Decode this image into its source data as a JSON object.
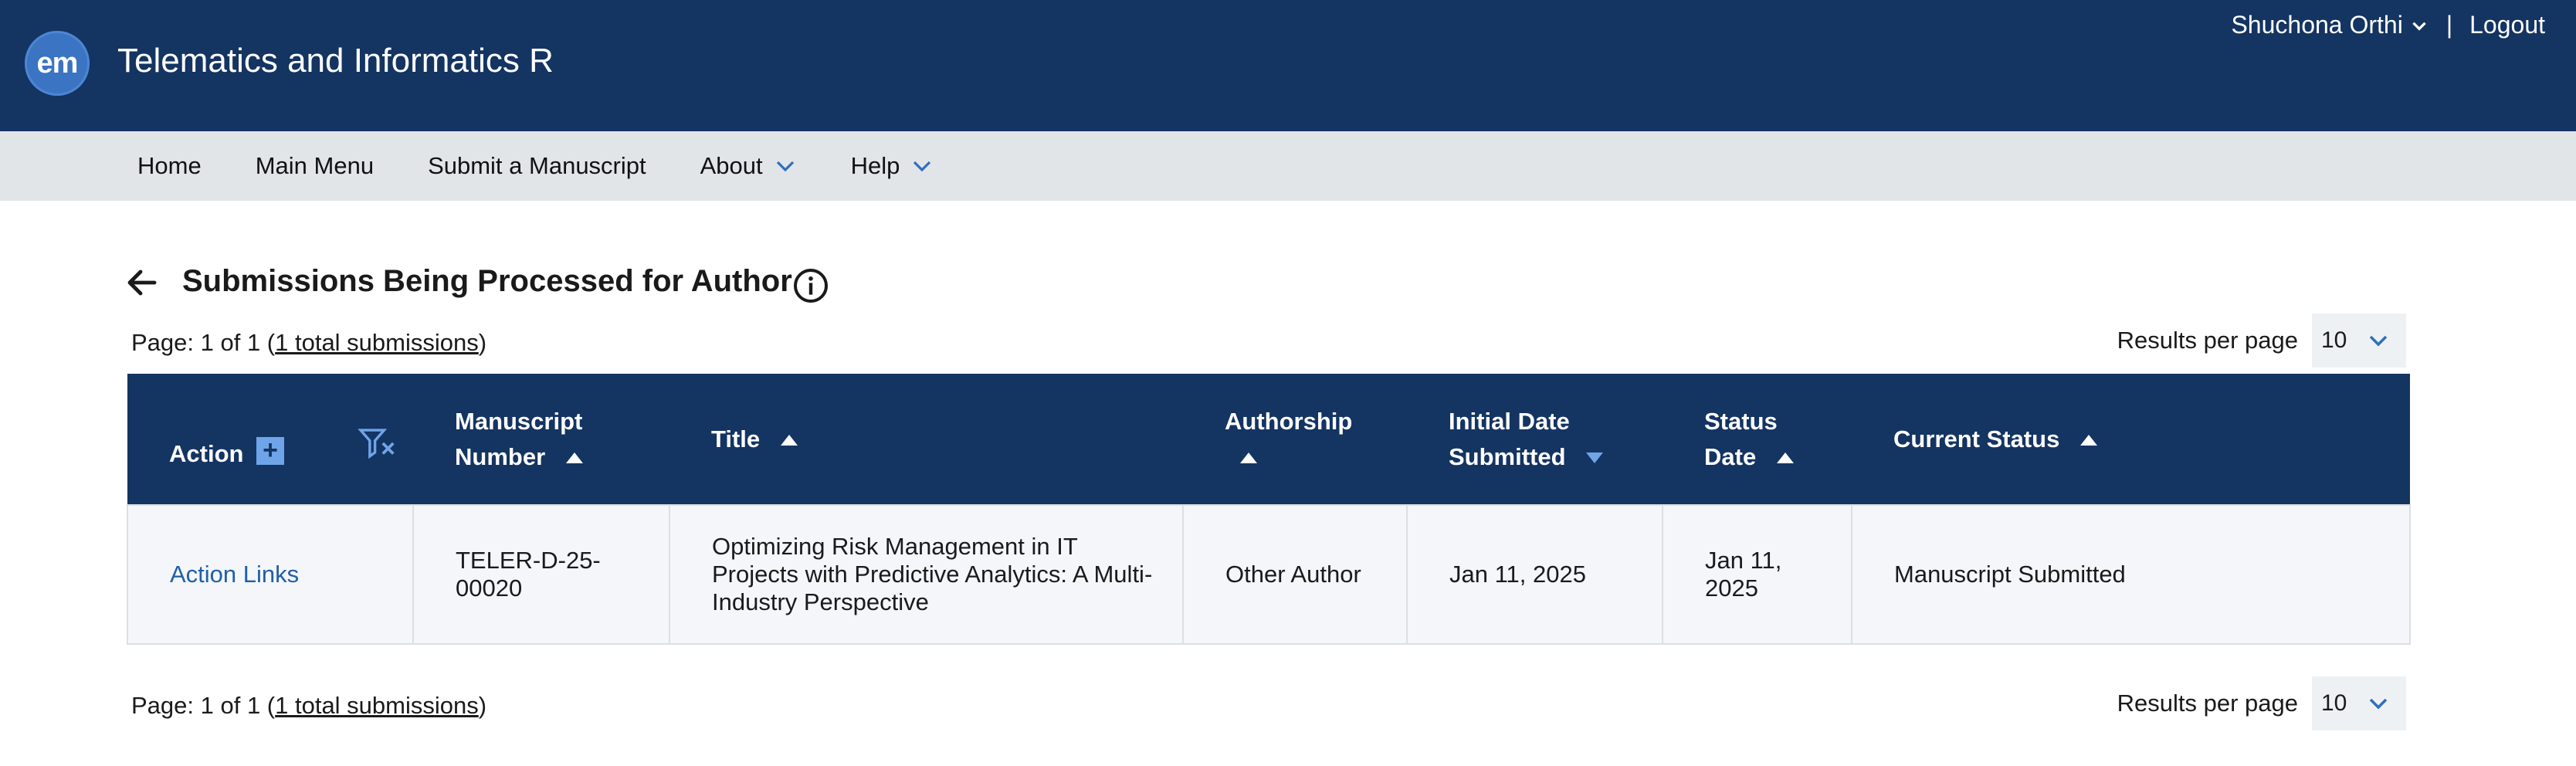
{
  "header": {
    "logo_text": "em",
    "journal_title": "Telematics and Informatics R",
    "user_name": "Shuchona Orthi",
    "separator": "|",
    "logout_label": "Logout",
    "bg_color": "#143462",
    "logo_color": "#3a74c2"
  },
  "nav": {
    "home": "Home",
    "main_menu": "Main Menu",
    "submit": "Submit a Manuscript",
    "about": "About",
    "help": "Help"
  },
  "page": {
    "title": "Submissions Being Processed for Author",
    "pager_prefix": "Page: 1 of 1 (",
    "pager_link": "1 total submissions",
    "pager_suffix": ")",
    "results_per_page_label": "Results per page",
    "results_per_page_value": "10"
  },
  "table": {
    "columns": {
      "action": "Action",
      "manuscript_number_line1": "Manuscript",
      "manuscript_number_line2": "Number",
      "title": "Title",
      "authorship": "Authorship",
      "initial_date_line1": "Initial Date",
      "initial_date_line2": "Submitted",
      "status_date_line1": "Status",
      "status_date_line2": "Date",
      "current_status": "Current Status"
    },
    "rows": [
      {
        "action": "Action Links",
        "manuscript_number": "TELER-D-25-00020",
        "title": "Optimizing Risk Management in IT Projects with Predictive Analytics: A Multi-Industry Perspective",
        "authorship": "Other Author",
        "initial_date": "Jan 11, 2025",
        "status_date": "Jan 11, 2025",
        "current_status": "Manuscript Submitted"
      }
    ],
    "accent_color": "#6fa5e8",
    "link_color": "#1f5fa6"
  }
}
